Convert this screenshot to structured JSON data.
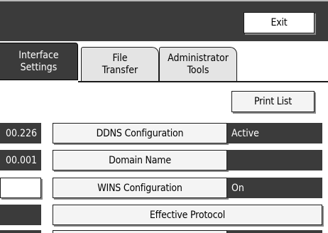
{
  "header": {
    "exit_label": "Exit"
  },
  "tabs": [
    {
      "line1": "Interface",
      "line2": "Settings",
      "active": true
    },
    {
      "line1": "File",
      "line2": "Transfer",
      "active": false
    },
    {
      "line1": "Administrator",
      "line2": "Tools",
      "active": false
    }
  ],
  "toolbar": {
    "print_list_label": "Print List"
  },
  "rows": [
    {
      "left_value": "00.226",
      "button_label": "DDNS Configuration",
      "status": "Active"
    },
    {
      "left_value": "00.001",
      "button_label": "Domain Name",
      "status": ""
    },
    {
      "left_value": "",
      "button_label": "WINS Configuration",
      "status": "On"
    },
    {
      "left_value": "",
      "button_label": "Effective Protocol",
      "status": ""
    }
  ]
}
